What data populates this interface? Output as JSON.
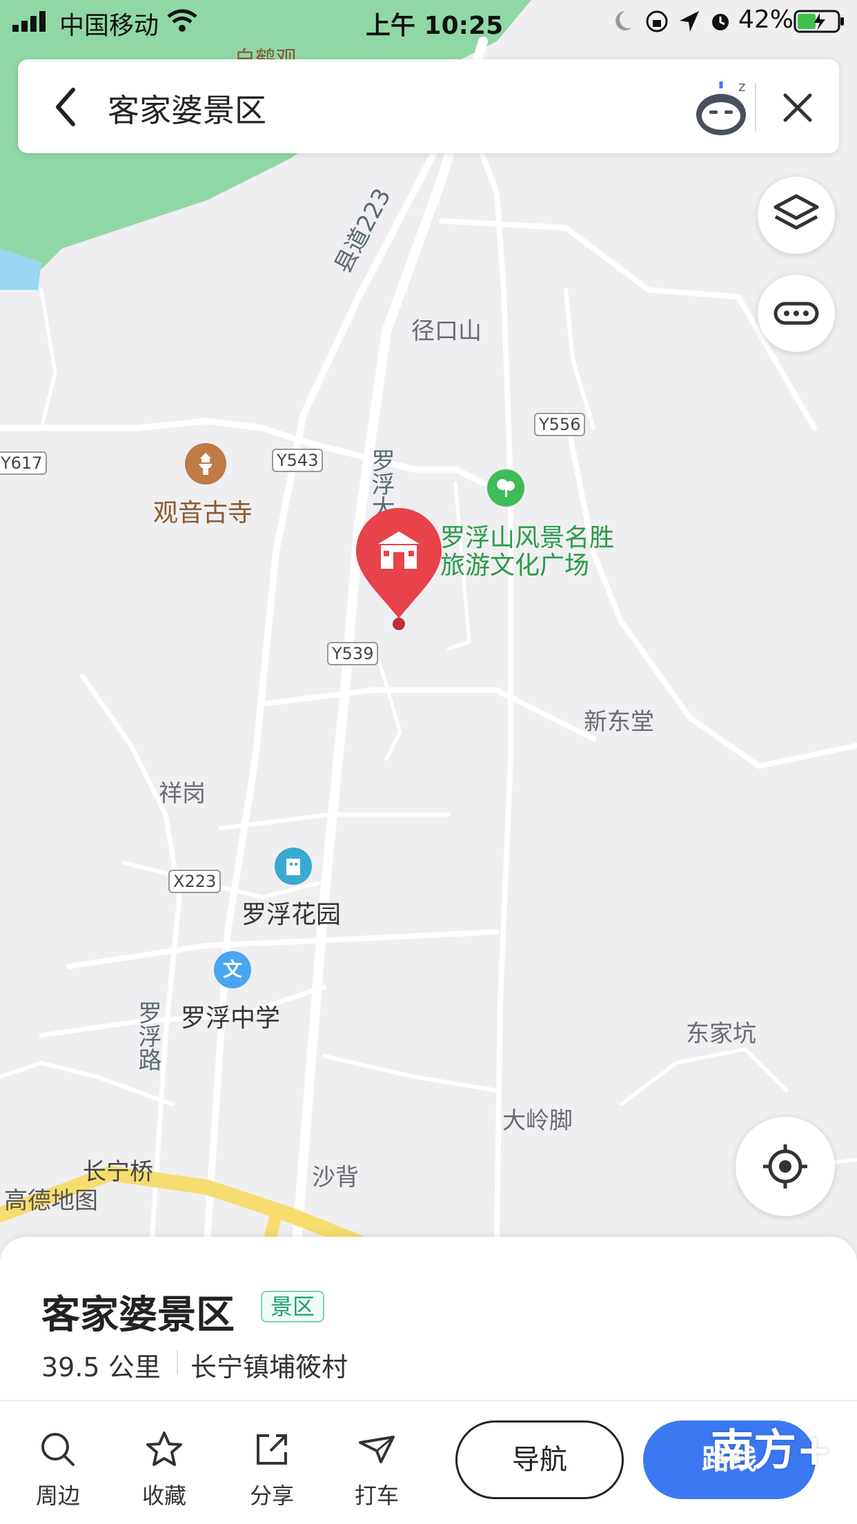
{
  "status_bar": {
    "carrier": "中国移动",
    "time": "上午 10:25",
    "battery": "42%"
  },
  "search": {
    "query": "客家婆景区"
  },
  "map": {
    "place_labels": [
      {
        "id": "jingkoushan",
        "text": "径口山"
      },
      {
        "id": "xindongtang",
        "text": "新东堂"
      },
      {
        "id": "xianggang",
        "text": "祥岗"
      },
      {
        "id": "dongjiakeng",
        "text": "东家坑"
      },
      {
        "id": "dalingjiao",
        "text": "大岭脚"
      },
      {
        "id": "shabei",
        "text": "沙背"
      },
      {
        "id": "changningqiao",
        "text": "长宁桥"
      },
      {
        "id": "baihe",
        "text": "白鹤观"
      }
    ],
    "road_tags": [
      "Y556",
      "Y543",
      "Y539",
      "X223",
      "Y617"
    ],
    "road_names": {
      "county_road": "县道223",
      "luofu_avenue": "罗浮大道",
      "luofu_road": "罗浮路"
    },
    "pois": {
      "guanyin": "观音古寺",
      "scenic_line1": "罗浮山风景名胜",
      "scenic_line2": "旅游文化广场",
      "garden": "罗浮花园",
      "school": "罗浮中学"
    },
    "amap_logo": "高德地图"
  },
  "place_card": {
    "name": "客家婆景区",
    "category_tag": "景区",
    "distance": "39.5 公里",
    "address": "长宁镇埔筱村"
  },
  "actions": {
    "nearby": "周边",
    "favorite": "收藏",
    "share": "分享",
    "taxi": "打车",
    "navigate": "导航",
    "route": "路线"
  },
  "watermark": "南方+",
  "colors": {
    "marker_red": "#e8424a",
    "route_blue": "#3b78f2",
    "park_green": "#8fd8a6",
    "highway_yellow": "#f7dc6f"
  }
}
